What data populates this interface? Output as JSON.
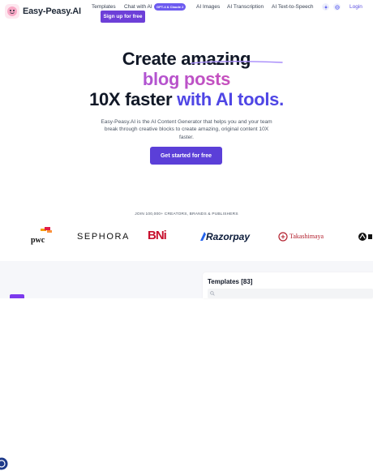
{
  "nav": {
    "logo_text": "Easy-Peasy.AI",
    "links": [
      "Templates",
      "Chat with AI",
      "AI Images",
      "AI Transcription",
      "AI Text-to-Speech"
    ],
    "chat_badge": "GPT-4 & Claude 2",
    "login": "Login",
    "signup": "Sign up for free"
  },
  "hero": {
    "line1": "Create amazing",
    "line2": "blog posts",
    "line3_prefix": "10X faster ",
    "line3_accent": "with AI tools.",
    "description": "Easy-Peasy.AI is the AI Content Generator that helps you and your team break through creative blocks to create amazing, original content 10X faster.",
    "cta": "Get started for free"
  },
  "social_proof": {
    "heading": "JOIN 100,000+ CREATORS, BRANDS & PUBLISHERS",
    "brands": [
      "pwc",
      "SEPHORA",
      "BNi",
      "Razorpay",
      "Takashimaya"
    ]
  },
  "templates": {
    "title": "Templates [83]"
  },
  "colors": {
    "primary": "#5b3fd8",
    "accent": "#4f46e5",
    "gradient_start": "#8b5cf6",
    "gradient_end": "#ec4899"
  }
}
